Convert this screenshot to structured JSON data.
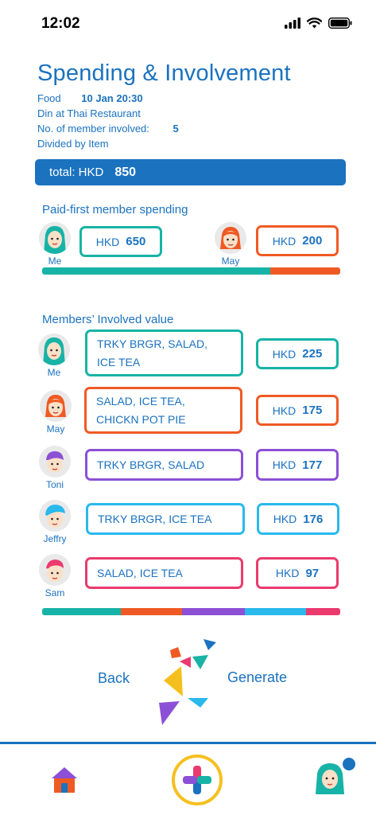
{
  "status": {
    "time": "12:02"
  },
  "header": {
    "title": "Spending & Involvement",
    "category": "Food",
    "date": "10 Jan",
    "time": "20:30",
    "place": "Din at Thai Restaurant",
    "members_label": "No. of member involved:",
    "members_count": "5",
    "split_method": "Divided by Item"
  },
  "total": {
    "label": "total: HKD",
    "value": "850"
  },
  "paid_first": {
    "title": "Paid-first member spending",
    "members": [
      {
        "name": "Me",
        "currency": "HKD",
        "amount": 650,
        "color": "#17b3a6"
      },
      {
        "name": "May",
        "currency": "HKD",
        "amount": 200,
        "color": "#ef5a24"
      }
    ]
  },
  "involved": {
    "title": "Members’ Involved value",
    "members": [
      {
        "name": "Me",
        "line1": "TRKY BRGR, SALAD,",
        "line2": "ICE TEA",
        "currency": "HKD",
        "amount": 225,
        "color": "#17b3a6"
      },
      {
        "name": "May",
        "line1": "SALAD, ICE TEA,",
        "line2": "CHICKN POT PIE",
        "currency": "HKD",
        "amount": 175,
        "color": "#ef5a24"
      },
      {
        "name": "Toni",
        "line1": "TRKY BRGR, SALAD",
        "line2": "",
        "currency": "HKD",
        "amount": 177,
        "color": "#8c50d6"
      },
      {
        "name": "Jeffry",
        "line1": "TRKY BRGR, ICE TEA",
        "line2": "",
        "currency": "HKD",
        "amount": 176,
        "color": "#29b9ec"
      },
      {
        "name": "Sam",
        "line1": "SALAD, ICE TEA",
        "line2": "",
        "currency": "HKD",
        "amount": 97,
        "color": "#ea3a6e"
      }
    ]
  },
  "actions": {
    "back": "Back",
    "generate": "Generate"
  },
  "nav": {
    "items": [
      "home-icon",
      "add-icon",
      "profile-icon"
    ]
  }
}
